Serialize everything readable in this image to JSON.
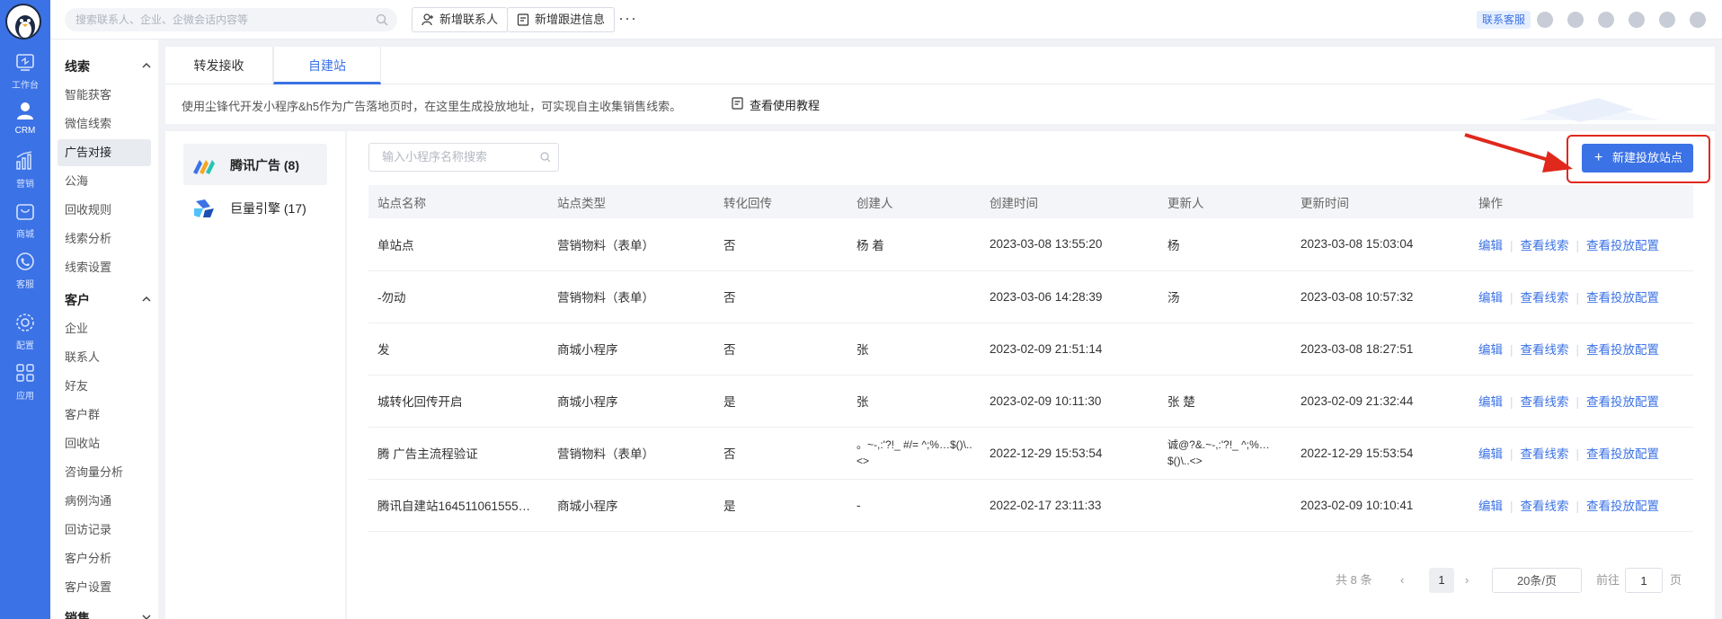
{
  "rail": {
    "items": [
      {
        "label": "工作台",
        "icon": "dashboard-icon"
      },
      {
        "label": "CRM",
        "icon": "user-icon"
      },
      {
        "label": "营销",
        "icon": "chart-icon"
      },
      {
        "label": "商城",
        "icon": "shop-icon"
      },
      {
        "label": "客服",
        "icon": "phone-icon"
      },
      {
        "label": "配置",
        "icon": "gear-icon"
      },
      {
        "label": "应用",
        "icon": "apps-icon"
      }
    ]
  },
  "topbar": {
    "search_placeholder": "搜索联系人、企业、企微会话内容等",
    "add_contact": "新增联系人",
    "add_followup": "新增跟进信息",
    "more": "···",
    "support": "联系客服"
  },
  "sidebar": {
    "group_leads": "线索",
    "leads_items": [
      "智能获客",
      "微信线索",
      "广告对接",
      "公海",
      "回收规则",
      "线索分析",
      "线索设置"
    ],
    "group_customers": "客户",
    "customer_items": [
      "企业",
      "联系人",
      "好友",
      "客户群",
      "回收站",
      "咨询量分析",
      "病例沟通",
      "回访记录",
      "客户分析",
      "客户设置"
    ],
    "group_sales": "销售"
  },
  "tabs": [
    "转发接收",
    "自建站"
  ],
  "banner": {
    "text": "使用尘锋代开发小程序&h5作为广告落地页时，在这里生成投放地址，可实现自主收集销售线索。",
    "link": "查看使用教程"
  },
  "channels": [
    {
      "label": "腾讯广告 (8)"
    },
    {
      "label": "巨量引擎 (17)"
    }
  ],
  "main": {
    "search_placeholder": "输入小程序名称搜索",
    "new_button": "新建投放站点",
    "columns": [
      "站点名称",
      "站点类型",
      "转化回传",
      "创建人",
      "创建时间",
      "更新人",
      "更新时间",
      "操作"
    ],
    "rows": [
      {
        "name": "单站点",
        "type": "营销物料（表单）",
        "conv": "否",
        "creator": "杨 着",
        "created": "2023-03-08 13:55:20",
        "updater": "杨",
        "updated": "2023-03-08 15:03:04"
      },
      {
        "name": "-勿动",
        "type": "营销物料（表单）",
        "conv": "否",
        "creator": "",
        "created": "2023-03-06 14:28:39",
        "updater": "汤",
        "updated": "2023-03-08 10:57:32"
      },
      {
        "name": "发",
        "type": "商城小程序",
        "conv": "否",
        "creator": "张",
        "created": "2023-02-09 21:51:14",
        "updater": "",
        "updated": "2023-03-08 18:27:51"
      },
      {
        "name": "城转化回传开启",
        "type": "商城小程序",
        "conv": "是",
        "creator": "张",
        "created": "2023-02-09 10:11:30",
        "updater": "张 楚",
        "updated": "2023-02-09 21:32:44"
      },
      {
        "name": "腾 广告主流程验证",
        "type": "营销物料（表单）",
        "conv": "否",
        "creator": "。~-,:'?!_ #/= ^;%…$()\\..<>",
        "created": "2022-12-29 15:53:54",
        "updater": "诚@?&.~-,:'?!_ ^;%…$()\\..<>",
        "updated": "2022-12-29 15:53:54"
      },
      {
        "name": "腾讯自建站164511061555…",
        "type": "商城小程序",
        "conv": "是",
        "creator": "-",
        "created": "2022-02-17 23:11:33",
        "updater": "",
        "updated": "2023-02-09 10:10:41"
      }
    ],
    "ops": [
      "编辑",
      "查看线索",
      "查看投放配置"
    ]
  },
  "pager": {
    "total": "共 8 条",
    "current": "1",
    "page_size": "20条/页",
    "goto_prefix": "前往",
    "goto_value": "1",
    "goto_suffix": "页"
  },
  "colors": {
    "accent": "#3b72e5",
    "highlight": "#e0281d"
  }
}
